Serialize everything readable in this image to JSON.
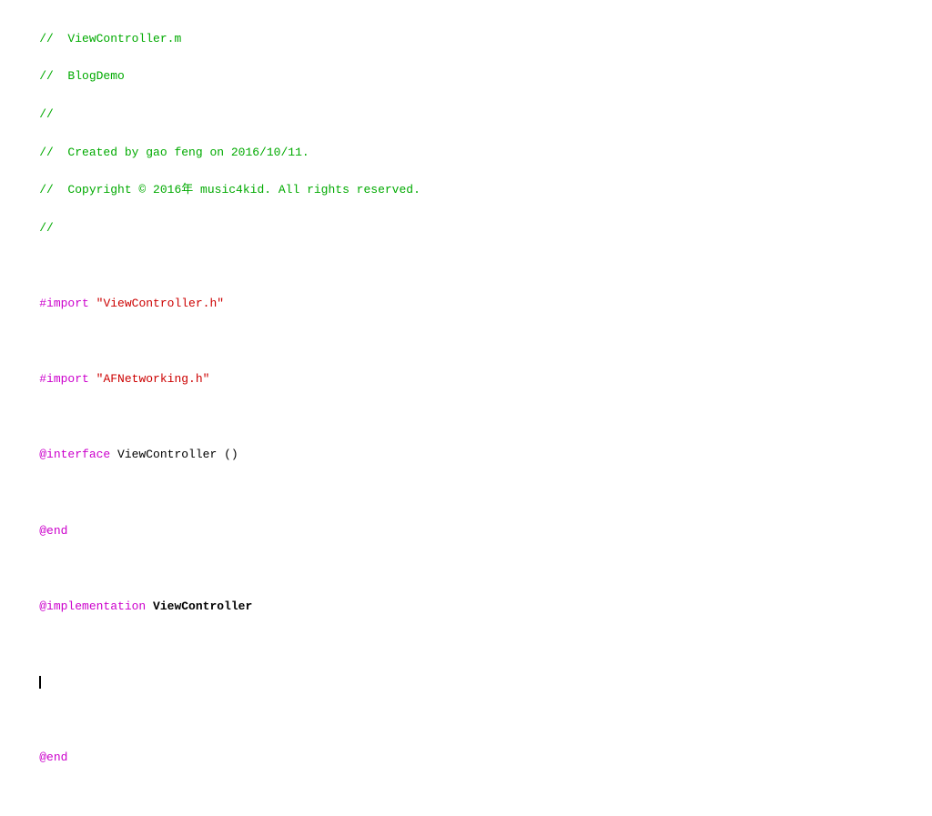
{
  "code": {
    "comments": [
      "//  ViewController.m",
      "//  BlogDemo",
      "//",
      "//  Created by gao feng on 2016/10/11.",
      "//  Copyright © 2016年 music4kid. All rights reserved.",
      "//"
    ],
    "imports": [
      {
        "keyword": "#import",
        "string": "\"ViewController.h\""
      },
      {
        "keyword": "#import",
        "string": "\"AFNetworking.h\""
      }
    ],
    "interface_line": {
      "keyword": "@interface",
      "classname": " ViewController",
      "rest": " ()"
    },
    "end1": "@end",
    "implementation_line": {
      "keyword": "@implementation",
      "classname": " ViewController"
    },
    "end2": "@end"
  }
}
